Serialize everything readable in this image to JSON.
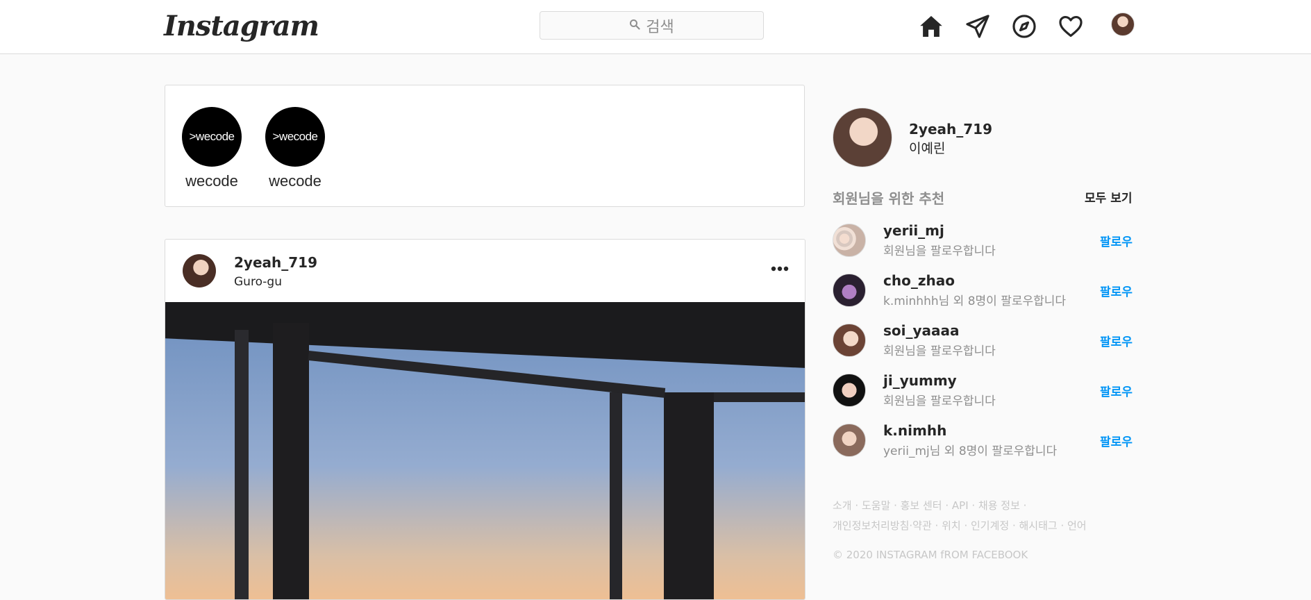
{
  "header": {
    "logo": "Instagram",
    "search_placeholder": "검색"
  },
  "stories": [
    {
      "image_text": ">wecode",
      "name": "wecode"
    },
    {
      "image_text": ">wecode",
      "name": "wecode"
    }
  ],
  "post": {
    "username": "2yeah_719",
    "location": "Guro-gu"
  },
  "sidebar": {
    "username": "2yeah_719",
    "fullname": "이예린",
    "recommend_title": "회원님을 위한 추천",
    "see_all": "모두 보기",
    "suggestions": [
      {
        "username": "yerii_mj",
        "subtitle": "회원님을 팔로우합니다",
        "action": "팔로우"
      },
      {
        "username": "cho_zhao",
        "subtitle": "k.minhhh님 외 8명이 팔로우합니다",
        "action": "팔로우"
      },
      {
        "username": "soi_yaaaa",
        "subtitle": "회원님을 팔로우합니다",
        "action": "팔로우"
      },
      {
        "username": "ji_yummy",
        "subtitle": "회원님을 팔로우합니다",
        "action": "팔로우"
      },
      {
        "username": "k.nimhh",
        "subtitle": "yerii_mj님 외 8명이 팔로우합니다",
        "action": "팔로우"
      }
    ],
    "footer_line1": "소개 · 도움말 · 홍보 센터 · API · 채용 정보 ·",
    "footer_line2": "개인정보처리방침·약관 · 위치 · 인기계정 · 해시태그 · 언어",
    "copyright": "© 2020 INSTAGRAM fROM FACEBOOK"
  },
  "colors": {
    "link_blue": "#0095f6",
    "border": "#dbdbdb",
    "background": "#fafafa",
    "muted_text": "#8e8e8e"
  }
}
